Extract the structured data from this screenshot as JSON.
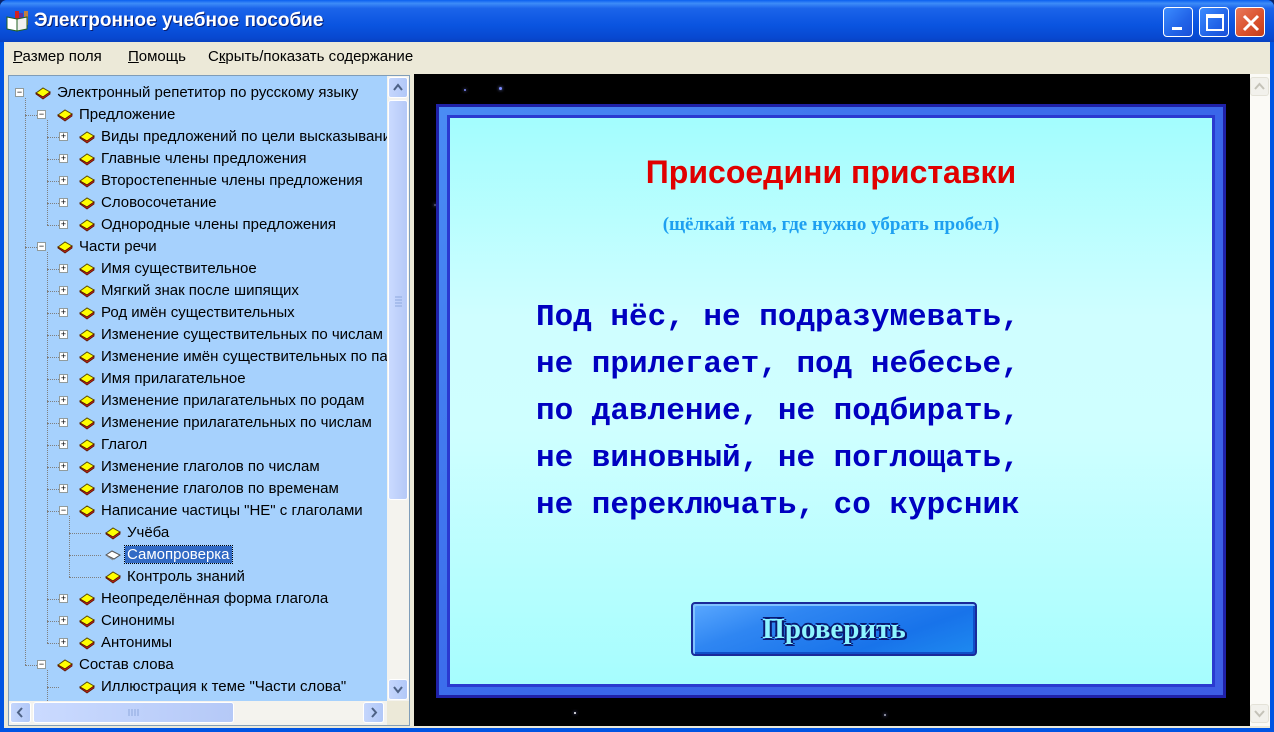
{
  "window": {
    "title": "Электронное учебное пособие"
  },
  "menu": [
    {
      "label": "Размер поля",
      "mnemonic": "Р",
      "rest": "азмер поля"
    },
    {
      "label": "Помощь",
      "mnemonic": "П",
      "rest": "омощь"
    },
    {
      "label": "Скрыть/показать содержание",
      "prefix": "С",
      "mnemonic": "к",
      "rest": "рыть/показать содержание"
    }
  ],
  "tree": {
    "items": [
      {
        "label": "Электронный репетитор по русскому языку",
        "level": 0,
        "expander": "minus"
      },
      {
        "label": "Предложение",
        "level": 1,
        "expander": "minus"
      },
      {
        "label": "Виды предложений по цели высказывания",
        "level": 2,
        "expander": "plus"
      },
      {
        "label": "Главные члены предложения",
        "level": 2,
        "expander": "plus"
      },
      {
        "label": "Второстепенные члены предложения",
        "level": 2,
        "expander": "plus"
      },
      {
        "label": "Словосочетание",
        "level": 2,
        "expander": "plus"
      },
      {
        "label": "Однородные члены предложения",
        "level": 2,
        "expander": "plus"
      },
      {
        "label": "Части речи",
        "level": 1,
        "expander": "minus"
      },
      {
        "label": "Имя существительное",
        "level": 2,
        "expander": "plus"
      },
      {
        "label": "Мягкий знак после шипящих",
        "level": 2,
        "expander": "plus"
      },
      {
        "label": "Род имён существительных",
        "level": 2,
        "expander": "plus"
      },
      {
        "label": "Изменение существительных по числам",
        "level": 2,
        "expander": "plus"
      },
      {
        "label": "Изменение имён существительных по падежам",
        "level": 2,
        "expander": "plus"
      },
      {
        "label": "Имя прилагательное",
        "level": 2,
        "expander": "plus"
      },
      {
        "label": "Изменение прилагательных по родам",
        "level": 2,
        "expander": "plus"
      },
      {
        "label": "Изменение прилагательных по числам",
        "level": 2,
        "expander": "plus"
      },
      {
        "label": "Глагол",
        "level": 2,
        "expander": "plus"
      },
      {
        "label": "Изменение глаголов по числам",
        "level": 2,
        "expander": "plus"
      },
      {
        "label": "Изменение глаголов по временам",
        "level": 2,
        "expander": "plus"
      },
      {
        "label": "Написание частицы \"НЕ\" с глаголами",
        "level": 2,
        "expander": "minus"
      },
      {
        "label": "Учёба",
        "level": 3,
        "expander": "none"
      },
      {
        "label": "Самопроверка",
        "level": 3,
        "expander": "none",
        "selected": true
      },
      {
        "label": "Контроль знаний",
        "level": 3,
        "expander": "none"
      },
      {
        "label": "Неопределённая форма глагола",
        "level": 2,
        "expander": "plus"
      },
      {
        "label": "Синонимы",
        "level": 2,
        "expander": "plus"
      },
      {
        "label": "Антонимы",
        "level": 2,
        "expander": "plus"
      },
      {
        "label": "Состав слова",
        "level": 1,
        "expander": "minus"
      },
      {
        "label": "Иллюстрация к теме \"Части слова\"",
        "level": 2,
        "expander": "none"
      }
    ]
  },
  "slide": {
    "title": "Присоедини приставки",
    "subtitle": "(щёлкай там, где нужно убрать пробел)",
    "lines": [
      "Под нёс, не подразумевать,",
      "не прилегает, под небесье,",
      "по давление, не подбирать,",
      "не виновный, не поглощать,",
      "не переключать, со курсник"
    ],
    "check_button": "Проверить"
  },
  "colors": {
    "title_accent": "#e00000",
    "subtitle": "#1ea0f0",
    "exercise_text": "#0000c0",
    "tree_background": "#a6d1fd",
    "selection": "#316ac5"
  }
}
